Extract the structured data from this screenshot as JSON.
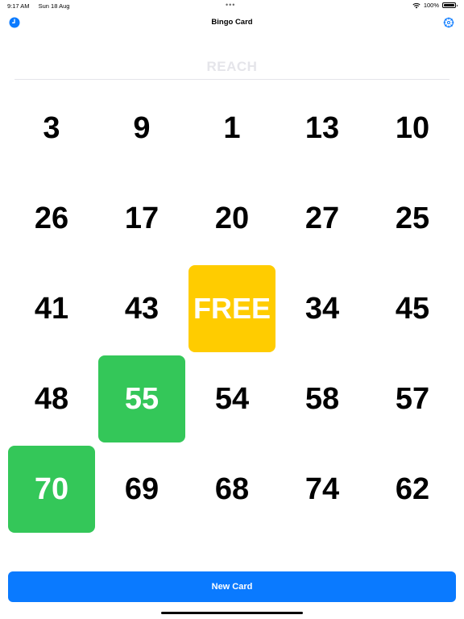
{
  "status_bar": {
    "time": "9:17 AM",
    "date": "Sun 18 Aug",
    "dots": "•••",
    "battery": "100%",
    "icons": [
      "wifi-icon",
      "battery-icon"
    ]
  },
  "nav": {
    "title": "Bingo Card",
    "left_icon": "clock-icon",
    "right_icon": "gear-icon"
  },
  "reach_label": "REACH",
  "colors": {
    "accent": "#0a7aff",
    "marked": "#34c759",
    "free": "#ffcc00",
    "reach_text": "#e5e5ea"
  },
  "card": {
    "rows": [
      [
        {
          "v": "3",
          "state": "unmarked"
        },
        {
          "v": "9",
          "state": "unmarked"
        },
        {
          "v": "1",
          "state": "unmarked"
        },
        {
          "v": "13",
          "state": "unmarked"
        },
        {
          "v": "10",
          "state": "unmarked"
        }
      ],
      [
        {
          "v": "26",
          "state": "unmarked"
        },
        {
          "v": "17",
          "state": "unmarked"
        },
        {
          "v": "20",
          "state": "unmarked"
        },
        {
          "v": "27",
          "state": "unmarked"
        },
        {
          "v": "25",
          "state": "unmarked"
        }
      ],
      [
        {
          "v": "41",
          "state": "unmarked"
        },
        {
          "v": "43",
          "state": "unmarked"
        },
        {
          "v": "FREE",
          "state": "free"
        },
        {
          "v": "34",
          "state": "unmarked"
        },
        {
          "v": "45",
          "state": "unmarked"
        }
      ],
      [
        {
          "v": "48",
          "state": "unmarked"
        },
        {
          "v": "55",
          "state": "marked"
        },
        {
          "v": "54",
          "state": "unmarked"
        },
        {
          "v": "58",
          "state": "unmarked"
        },
        {
          "v": "57",
          "state": "unmarked"
        }
      ],
      [
        {
          "v": "70",
          "state": "marked"
        },
        {
          "v": "69",
          "state": "unmarked"
        },
        {
          "v": "68",
          "state": "unmarked"
        },
        {
          "v": "74",
          "state": "unmarked"
        },
        {
          "v": "62",
          "state": "unmarked"
        }
      ]
    ]
  },
  "new_card_label": "New Card"
}
